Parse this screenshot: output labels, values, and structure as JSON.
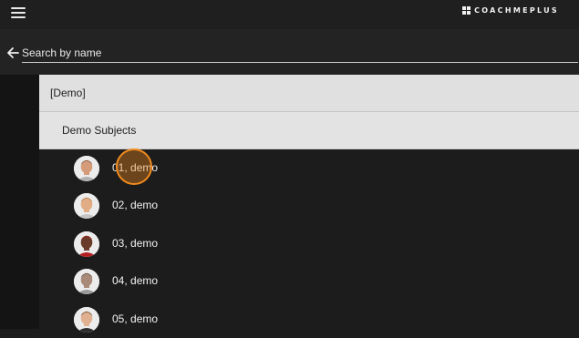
{
  "header": {
    "brand": "COACHMEPLUS"
  },
  "search": {
    "placeholder": "Search by name"
  },
  "groups": {
    "group_label": "[Demo]",
    "subgroup_label": "Demo Subjects"
  },
  "subjects": [
    {
      "name": "01, demo",
      "skin": "#d69c7a",
      "hair": "#6b4a35",
      "shirt": "#b0b0b0"
    },
    {
      "name": "02, demo",
      "skin": "#e2ad84",
      "hair": "#a57245",
      "shirt": "#c4c4c4"
    },
    {
      "name": "03, demo",
      "skin": "#6a3b2a",
      "hair": "#b01c1c",
      "shirt": "#b41e1e"
    },
    {
      "name": "04, demo",
      "skin": "#a98a78",
      "hair": "#5a4a42",
      "shirt": "#9a9a9a"
    },
    {
      "name": "05, demo",
      "skin": "#e1b090",
      "hair": "#4a3428",
      "shirt": "#2e2e2e"
    }
  ],
  "colors": {
    "touch_indicator": "#f08a1e",
    "list_background": "#1c1c1c",
    "group_background": "#e0e0e0"
  },
  "icons": {
    "menu": "hamburger-menu-icon",
    "back": "arrow-left-icon",
    "brand": "coachmeplus-logo-icon",
    "avatar": "person-avatar-icon"
  }
}
